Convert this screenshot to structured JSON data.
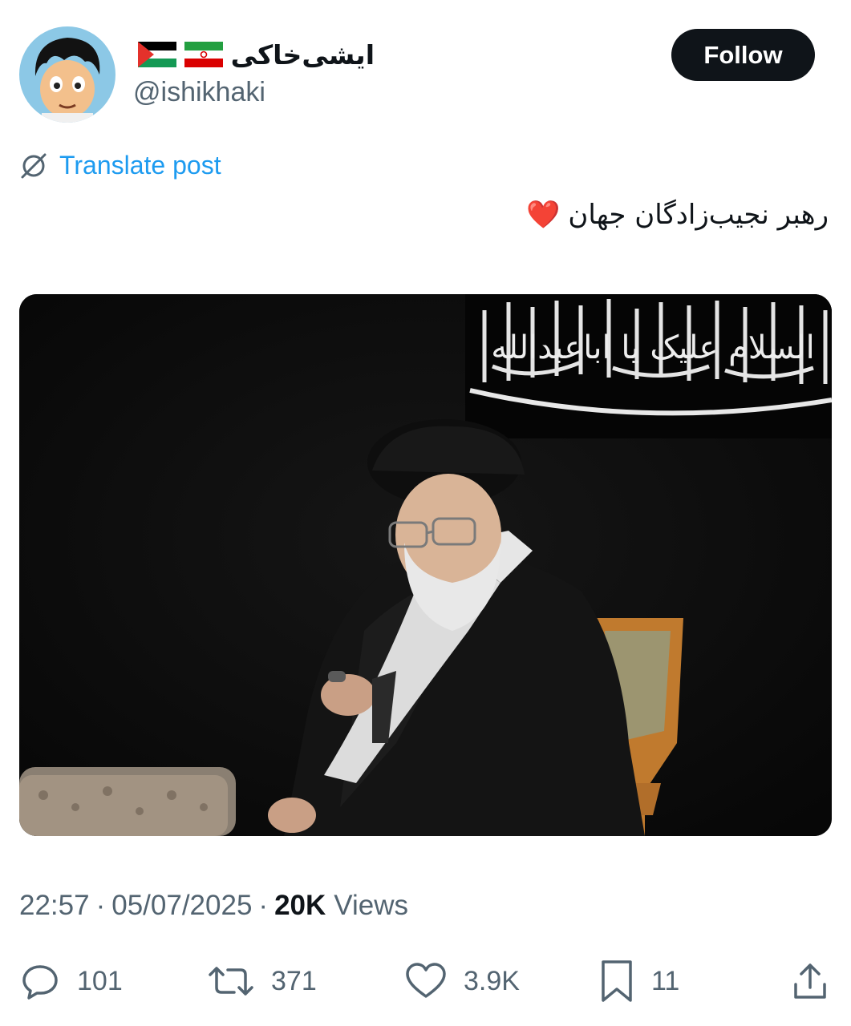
{
  "author": {
    "display_name": "ایشی‌خاکی",
    "handle": "@ishikhaki",
    "flags": [
      "iran-flag",
      "palestine-flag"
    ]
  },
  "follow_button": {
    "label": "Follow"
  },
  "translate": {
    "label": "Translate post",
    "icon": "globe-slash-icon"
  },
  "post": {
    "text": "رهبر نجیب‌زادگان جهان",
    "emoji": "❤️"
  },
  "media": {
    "banner_text": "السلام علیک یا اباعبدالله"
  },
  "meta": {
    "time": "22:57",
    "date": "05/07/2025",
    "views_count": "20K",
    "views_label": "Views"
  },
  "actions": {
    "replies": "101",
    "reposts": "371",
    "likes": "3.9K",
    "bookmarks": "11"
  },
  "colors": {
    "accent": "#1d9bf0",
    "text": "#0f1419",
    "secondary": "#536471",
    "button_bg": "#0f1419"
  }
}
